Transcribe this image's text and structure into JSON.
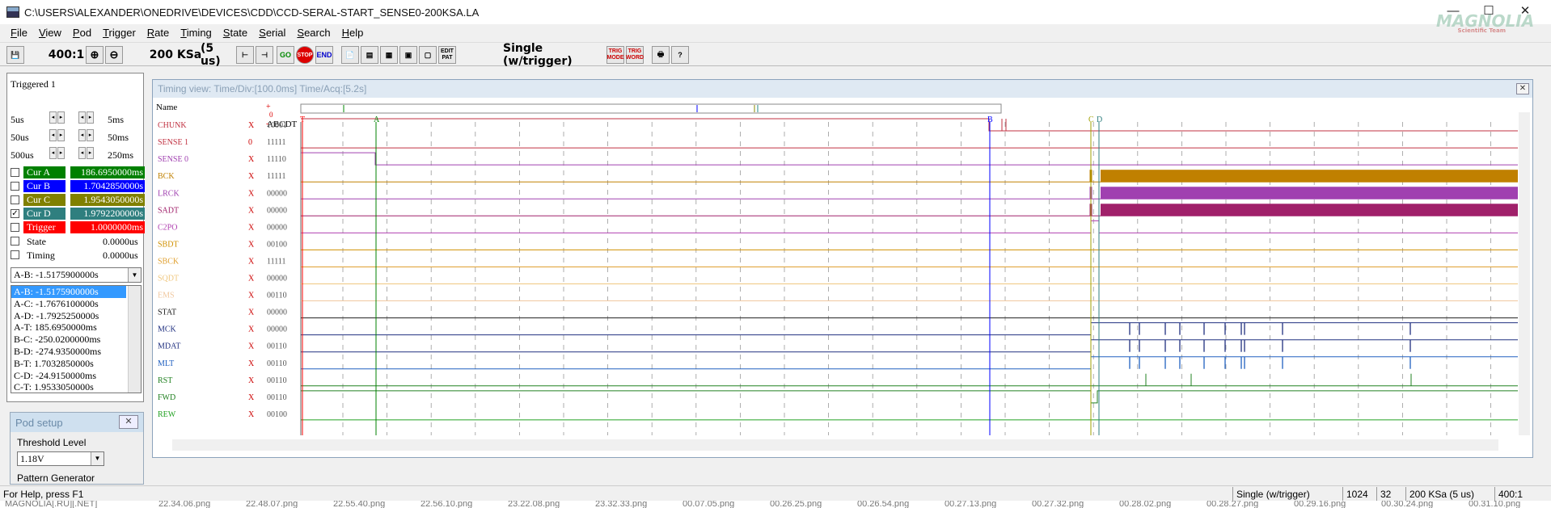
{
  "window": {
    "title": "C:\\USERS\\ALEXANDER\\ONEDRIVE\\DEVICES\\CDD\\CCD-SERAL-START_SENSE0-200KSA.LA",
    "minimize": "—",
    "maximize": "☐",
    "close": "✕",
    "logo": "MAGNOLIA",
    "logo_sub": "Scientific Team"
  },
  "menu": [
    "File",
    "View",
    "Pod",
    "Trigger",
    "Rate",
    "Timing",
    "State",
    "Serial",
    "Search",
    "Help"
  ],
  "toolbar": {
    "zoom": "400:1",
    "rate": "200 KSa",
    "period": "(5 us)",
    "mode": "Single (w/trigger)",
    "go": "GO",
    "stop": "STOP",
    "end": "END",
    "trig_mode": "TRIG MODE",
    "trig_word": "TRIG WORD",
    "edit_pat": "EDIT PAT"
  },
  "left": {
    "status": "Triggered 1",
    "spins": [
      [
        "5us",
        "5ms"
      ],
      [
        "50us",
        "50ms"
      ],
      [
        "500us",
        "250ms"
      ]
    ],
    "cursors": [
      {
        "label": "Cur A",
        "value": "186.6950000ms",
        "color": "#008000",
        "checked": false
      },
      {
        "label": "Cur B",
        "value": "1.7042850000s",
        "color": "#0000ff",
        "checked": false
      },
      {
        "label": "Cur C",
        "value": "1.9543050000s",
        "color": "#808000",
        "checked": false
      },
      {
        "label": "Cur D",
        "value": "1.9792200000s",
        "color": "#2f7f7f",
        "checked": true
      },
      {
        "label": "Trigger",
        "value": "1.0000000ms",
        "color": "#ff0000",
        "checked": false
      }
    ],
    "state": {
      "label": "State",
      "value": "0.0000us"
    },
    "timing": {
      "label": "Timing",
      "value": "0.0000us"
    },
    "selected_diff": "A-B: -1.5175900000s",
    "diffs": [
      "A-B: -1.5175900000s",
      "A-C: -1.7676100000s",
      "A-D: -1.7925250000s",
      "A-T: 185.6950000ms",
      "B-C: -250.0200000ms",
      "B-D: -274.9350000ms",
      "B-T: 1.7032850000s",
      "C-D: -24.9150000ms",
      "C-T: 1.9533050000s"
    ]
  },
  "pod": {
    "title": "Pod setup",
    "threshold_label": "Threshold Level",
    "threshold_value": "1.18V",
    "pattern": "Pattern Generator"
  },
  "timing_view": {
    "title": "Timing view:  Time/Div:[100.0ms] Time/Acq:[5.2s]",
    "name_header": "Name",
    "col_header": "ABCDT",
    "markers": {
      "T": "T",
      "A": "A",
      "B": "B",
      "C": "C",
      "D": "D"
    },
    "marker_colors": {
      "T": "#ff0000",
      "A": "#008000",
      "B": "#0000ff",
      "C": "#a0a000",
      "D": "#2f7f7f"
    },
    "signals": [
      {
        "name": "CHUNK",
        "x": "X",
        "bits": "10001",
        "color": "#c03040"
      },
      {
        "name": "SENSE 1",
        "x": "0",
        "bits": "11111",
        "color": "#c03040"
      },
      {
        "name": "SENSE 0",
        "x": "X",
        "bits": "11110",
        "color": "#a040b0"
      },
      {
        "name": "BCK",
        "x": "X",
        "bits": "11111",
        "color": "#c08000"
      },
      {
        "name": "LRCK",
        "x": "X",
        "bits": "00000",
        "color": "#a040b0"
      },
      {
        "name": "SADT",
        "x": "X",
        "bits": "00000",
        "color": "#a0206a"
      },
      {
        "name": "C2PO",
        "x": "X",
        "bits": "00000",
        "color": "#b040b0"
      },
      {
        "name": "SBDT",
        "x": "X",
        "bits": "00100",
        "color": "#d09000"
      },
      {
        "name": "SBCK",
        "x": "X",
        "bits": "11111",
        "color": "#e0a030"
      },
      {
        "name": "SQDT",
        "x": "X",
        "bits": "00000",
        "color": "#f0c880"
      },
      {
        "name": "EMS",
        "x": "X",
        "bits": "00110",
        "color": "#f0c8a0"
      },
      {
        "name": "STAT",
        "x": "X",
        "bits": "00000",
        "color": "#202020"
      },
      {
        "name": "MCK",
        "x": "X",
        "bits": "00000",
        "color": "#203080"
      },
      {
        "name": "MDAT",
        "x": "X",
        "bits": "00110",
        "color": "#203080"
      },
      {
        "name": "MLT",
        "x": "X",
        "bits": "00110",
        "color": "#2060c0"
      },
      {
        "name": "RST",
        "x": "X",
        "bits": "00110",
        "color": "#208020"
      },
      {
        "name": "FWD",
        "x": "X",
        "bits": "00110",
        "color": "#208020"
      },
      {
        "name": "REW",
        "x": "X",
        "bits": "00100",
        "color": "#20a020"
      }
    ]
  },
  "status": {
    "help": "For Help, press F1",
    "mode": "Single (w/trigger)",
    "depth": "1024",
    "width": "32",
    "rate": "200 KSa  (5 us)",
    "zoom": "400:1"
  },
  "underlay": [
    "MAGNOLIA[.RU][.NET]",
    "22.34.06.png",
    "22.48.07.png",
    "22.55.40.png",
    "22.56.10.png",
    "23.22.08.png",
    "23.32.33.png",
    "00.07.05.png",
    "00.26.25.png",
    "00.26.54.png",
    "00.27.13.png",
    "00.27.32.png",
    "00.28.02.png",
    "00.28.27.png",
    "00.29.16.png",
    "00.30.24.png",
    "00.31.10.png"
  ]
}
